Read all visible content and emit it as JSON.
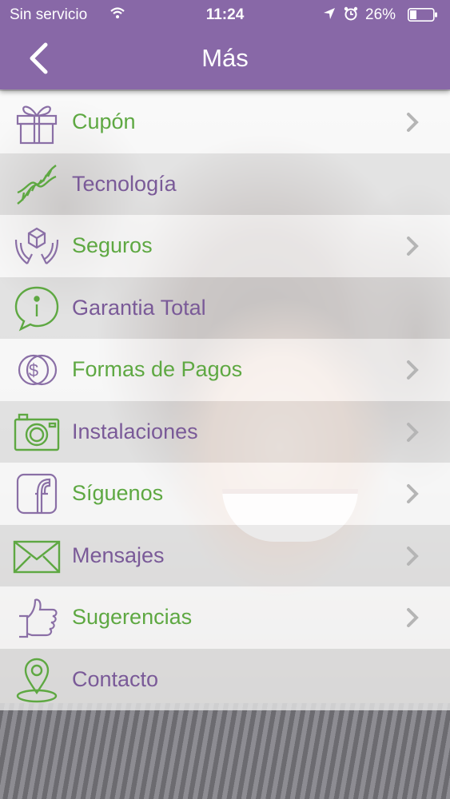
{
  "status_bar": {
    "carrier": "Sin servicio",
    "time": "11:24",
    "battery": "26%"
  },
  "header": {
    "title": "Más",
    "back_icon": "chevron-left-icon"
  },
  "colors": {
    "header": "#8868a7",
    "green": "#5ea842",
    "purple": "#7a5a98"
  },
  "menu": {
    "items": [
      {
        "label": "Cupón",
        "icon": "gift-icon",
        "color": "green",
        "chevron": true
      },
      {
        "label": "Tecnología",
        "icon": "dna-icon",
        "color": "purple",
        "chevron": false
      },
      {
        "label": "Seguros",
        "icon": "hands-box-icon",
        "color": "green",
        "chevron": true
      },
      {
        "label": "Garantia Total",
        "icon": "info-bubble-icon",
        "color": "purple",
        "chevron": false
      },
      {
        "label": "Formas de Pagos",
        "icon": "coins-icon",
        "color": "green",
        "chevron": true
      },
      {
        "label": "Instalaciones",
        "icon": "camera-icon",
        "color": "purple",
        "chevron": true
      },
      {
        "label": "Síguenos",
        "icon": "facebook-icon",
        "color": "green",
        "chevron": true
      },
      {
        "label": "Mensajes",
        "icon": "envelope-icon",
        "color": "purple",
        "chevron": true
      },
      {
        "label": "Sugerencias",
        "icon": "thumbs-up-icon",
        "color": "green",
        "chevron": true
      },
      {
        "label": "Contacto",
        "icon": "map-pin-icon",
        "color": "purple",
        "chevron": false
      }
    ]
  }
}
